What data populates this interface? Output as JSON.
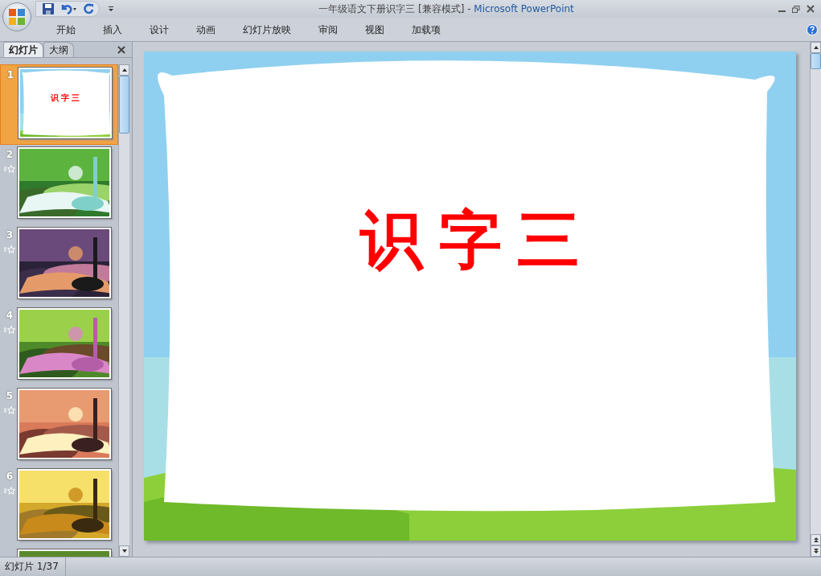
{
  "window": {
    "doc_title": "一年级语文下册识字三 [兼容模式]",
    "separator": "-",
    "app_name": "Microsoft PowerPoint"
  },
  "ribbon_tabs": [
    "开始",
    "插入",
    "设计",
    "动画",
    "幻灯片放映",
    "审阅",
    "视图",
    "加载项"
  ],
  "pane_tabs": [
    {
      "label": "幻灯片",
      "selected": true
    },
    {
      "label": "大纲",
      "selected": false
    }
  ],
  "slides": [
    {
      "number": "1",
      "selected": true,
      "animated": false,
      "kind": "title",
      "title": "识 字 三"
    },
    {
      "number": "2",
      "selected": false,
      "animated": true,
      "kind": "picture"
    },
    {
      "number": "3",
      "selected": false,
      "animated": true,
      "kind": "picture"
    },
    {
      "number": "4",
      "selected": false,
      "animated": true,
      "kind": "picture"
    },
    {
      "number": "5",
      "selected": false,
      "animated": true,
      "kind": "picture"
    },
    {
      "number": "6",
      "selected": false,
      "animated": true,
      "kind": "picture"
    },
    {
      "selected": false,
      "animated": false,
      "kind": "picture"
    }
  ],
  "current_slide": {
    "title": "识 字 三"
  },
  "status_bar": {
    "slide_count": "幻灯片 1/37"
  }
}
